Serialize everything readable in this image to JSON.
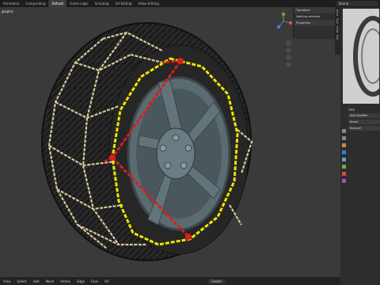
{
  "topbar": {
    "tabs": [
      "Animation",
      "Compositing",
      "Default",
      "Game Logic",
      "Scripting",
      "UV Editing",
      "Video Editing"
    ],
    "active_tab": "Default",
    "scene_label": "Scene"
  },
  "viewport": {
    "view_label": "graphic",
    "n_panel": {
      "transform_label": "Transform",
      "nothing_selected": "Nothing selected",
      "properties_label": "Properties"
    },
    "side_tabs": [
      "Item",
      "Tool",
      "View",
      "Edit"
    ]
  },
  "statusbar": {
    "menus": [
      "View",
      "Select",
      "Add",
      "Mesh",
      "Vertex",
      "Edge",
      "Face",
      "UV"
    ],
    "mode": "Global"
  },
  "rightpane": {
    "object_name": "TIRE",
    "modifier_label": "Add Modifier",
    "fields": [
      "Bevel",
      "Subsurf"
    ]
  },
  "colors": {
    "chain_gold": "#d8c79a",
    "chain_yellow": "#f2e400",
    "chain_red": "#d81e1e",
    "rim": "#5b6b72",
    "tire": "#202020"
  }
}
